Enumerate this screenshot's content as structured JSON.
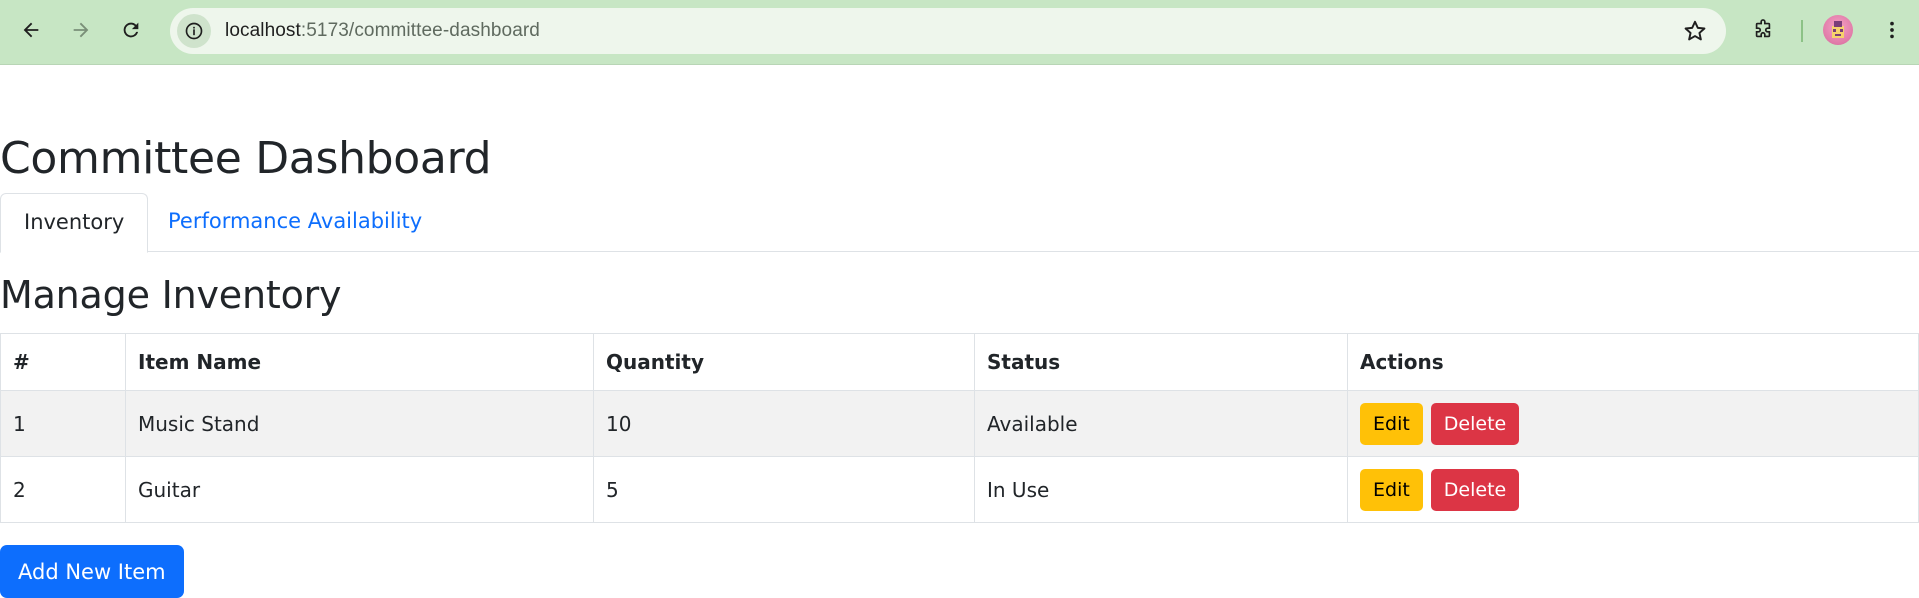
{
  "browser": {
    "url_host": "localhost",
    "url_path": ":5173/committee-dashboard",
    "icons": {
      "back": "back-arrow-icon",
      "forward": "forward-arrow-icon",
      "reload": "reload-icon",
      "site_info": "site-info-icon",
      "bookmark": "star-icon",
      "extensions": "puzzle-icon",
      "menu": "kebab-menu-icon"
    },
    "colors": {
      "frame": "#c7e6c4",
      "omnibox": "#eef6ec"
    }
  },
  "page": {
    "title": "Committee Dashboard",
    "tabs": [
      {
        "label": "Inventory",
        "active": true
      },
      {
        "label": "Performance Availability",
        "active": false
      }
    ],
    "section_title": "Manage Inventory",
    "table": {
      "headers": [
        "#",
        "Item Name",
        "Quantity",
        "Status",
        "Actions"
      ],
      "rows": [
        {
          "id": "1",
          "name": "Music Stand",
          "quantity": "10",
          "status": "Available",
          "edit_label": "Edit",
          "delete_label": "Delete"
        },
        {
          "id": "2",
          "name": "Guitar",
          "quantity": "5",
          "status": "In Use",
          "edit_label": "Edit",
          "delete_label": "Delete"
        }
      ]
    },
    "add_button_label": "Add New Item",
    "colors": {
      "primary": "#0d6efd",
      "warning": "#ffc107",
      "danger": "#dc3545"
    }
  }
}
